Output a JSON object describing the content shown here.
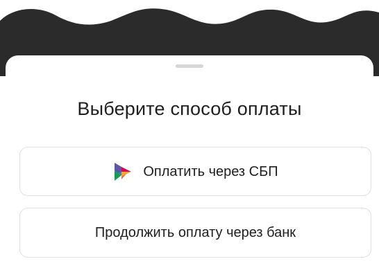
{
  "sheet": {
    "title": "Выберите способ оплаты"
  },
  "options": {
    "sbp": {
      "label": "Оплатить через СБП",
      "icon": "sbp-logo-icon"
    },
    "bank": {
      "label": "Продолжить оплату через банк"
    }
  },
  "colors": {
    "backdrop": "#2b2b2b",
    "sheet": "#ffffff",
    "text": "#1f1f1f",
    "button_border": "#e1e1e1",
    "grabber": "#d6d6d6"
  }
}
